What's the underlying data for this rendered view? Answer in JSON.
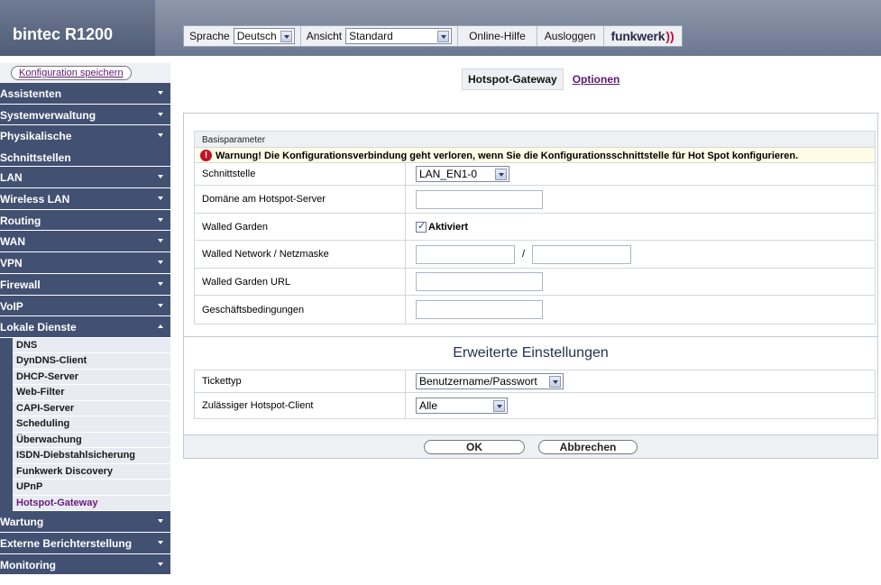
{
  "header": {
    "brand": "bintec R1200",
    "language_label": "Sprache",
    "language_value": "Deutsch",
    "view_label": "Ansicht",
    "view_value": "Standard",
    "help_label": "Online-Hilfe",
    "logout_label": "Ausloggen",
    "logo_text": "funkwerk"
  },
  "sidebar": {
    "save_label": "Konfiguration speichern",
    "items": [
      {
        "label": "Assistenten"
      },
      {
        "label": "Systemverwaltung"
      },
      {
        "label": "Physikalische Schnittstellen"
      },
      {
        "label": "LAN"
      },
      {
        "label": "Wireless LAN"
      },
      {
        "label": "Routing"
      },
      {
        "label": "WAN"
      },
      {
        "label": "VPN"
      },
      {
        "label": "Firewall"
      },
      {
        "label": "VoIP"
      },
      {
        "label": "Lokale Dienste"
      }
    ],
    "sub_items": [
      {
        "label": "DNS"
      },
      {
        "label": "DynDNS-Client"
      },
      {
        "label": "DHCP-Server"
      },
      {
        "label": "Web-Filter"
      },
      {
        "label": "CAPI-Server"
      },
      {
        "label": "Scheduling"
      },
      {
        "label": "Überwachung"
      },
      {
        "label": "ISDN-Diebstahlsicherung"
      },
      {
        "label": "Funkwerk Discovery"
      },
      {
        "label": "UPnP"
      },
      {
        "label": "Hotspot-Gateway"
      }
    ],
    "bottom_items": [
      {
        "label": "Wartung"
      },
      {
        "label": "Externe Berichterstellung"
      },
      {
        "label": "Monitoring"
      }
    ]
  },
  "tabs": {
    "active": "Hotspot-Gateway",
    "other": "Optionen"
  },
  "basic": {
    "section_title": "Basisparameter",
    "warning": "Warnung! Die Konfigurationsverbindung geht verloren, wenn Sie die Konfigurationsschnittstelle für Hot Spot konfigurieren.",
    "interface_label": "Schnittstelle",
    "interface_value": "LAN_EN1-0",
    "domain_label": "Domäne am Hotspot-Server",
    "domain_value": "",
    "walled_garden_label": "Walled Garden",
    "walled_garden_checkbox": "Aktiviert",
    "walled_network_label": "Walled Network / Netzmaske",
    "walled_network_value": "",
    "walled_mask_value": "",
    "separator": "/",
    "walled_url_label": "Walled Garden URL",
    "walled_url_value": "",
    "terms_label": "Geschäftsbedingungen",
    "terms_value": ""
  },
  "advanced": {
    "title": "Erweiterte Einstellungen",
    "ticket_label": "Tickettyp",
    "ticket_value": "Benutzername/Passwort",
    "client_label": "Zulässiger Hotspot-Client",
    "client_value": "Alle"
  },
  "buttons": {
    "ok": "OK",
    "cancel": "Abbrechen"
  }
}
